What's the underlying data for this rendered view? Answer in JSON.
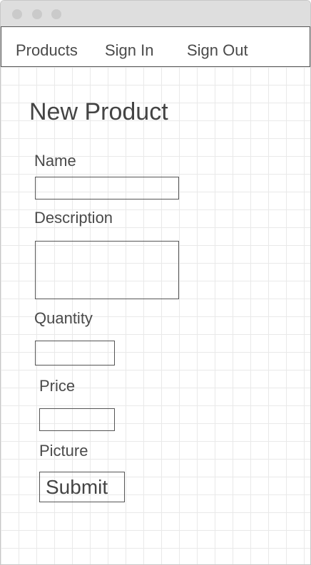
{
  "nav": {
    "products": "Products",
    "sign_in": "Sign In",
    "sign_out": "Sign Out"
  },
  "form": {
    "title": "New Product",
    "name_label": "Name",
    "name_value": "",
    "description_label": "Description",
    "description_value": "",
    "quantity_label": "Quantity",
    "quantity_value": "",
    "price_label": "Price",
    "price_value": "",
    "picture_label": "Picture",
    "submit_label": "Submit"
  }
}
